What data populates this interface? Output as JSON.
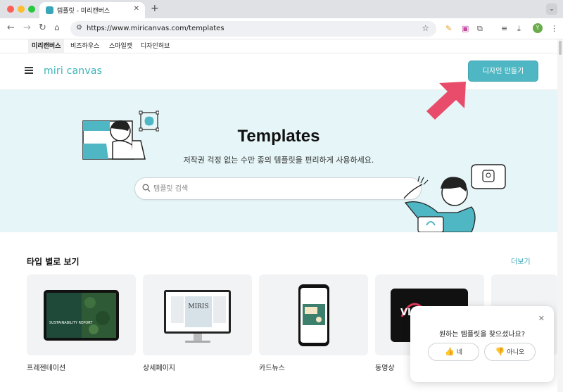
{
  "browser": {
    "tab_title": "템플릿 - 미리캔버스",
    "tab_close": "✕",
    "new_tab": "+",
    "url": "https://www.miricanvas.com/templates",
    "profile_initial": "Y"
  },
  "service_tabs": [
    {
      "label": "미리캔버스",
      "active": true
    },
    {
      "label": "비즈하우스",
      "active": false
    },
    {
      "label": "스마일캣",
      "active": false
    },
    {
      "label": "디자인허브",
      "active": false
    }
  ],
  "header": {
    "logo": "miri canvas",
    "create_button": "디자인 만들기"
  },
  "hero": {
    "title": "Templates",
    "subtitle": "저작권 걱정 없는 수만 종의 템플릿을 편리하게 사용하세요.",
    "search_placeholder": "템플릿 검색"
  },
  "section": {
    "title": "타입 별로 보기",
    "more": "더보기",
    "cards": [
      {
        "label": "프레젠테이션",
        "thumb_text": "SUSTAINABILITY REPORT"
      },
      {
        "label": "상세페이지",
        "thumb_text": "MIRIS"
      },
      {
        "label": "카드뉴스",
        "thumb_text": ""
      },
      {
        "label": "동영상",
        "thumb_text": "VL"
      }
    ]
  },
  "feedback": {
    "question": "원하는 템플릿을 찾으셨나요?",
    "yes": "네",
    "no": "아니오",
    "close": "✕"
  },
  "colors": {
    "brand": "#4fb7c3",
    "hero_bg": "#e6f5f7",
    "arrow": "#e84c6a"
  }
}
